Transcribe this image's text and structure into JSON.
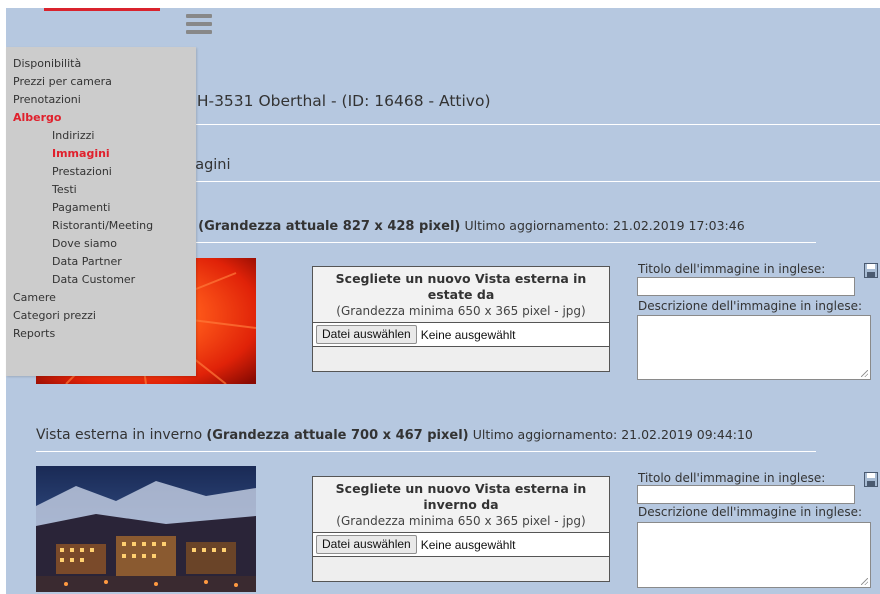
{
  "page": {
    "title": "CH-3531 Oberthal - (ID: 16468 - Attivo)",
    "section_title": "nagini"
  },
  "menu": {
    "items": [
      {
        "label": "Disponibilità",
        "level": 0,
        "active": false
      },
      {
        "label": "Prezzi per camera",
        "level": 0,
        "active": false
      },
      {
        "label": "Prenotazioni",
        "level": 0,
        "active": false
      },
      {
        "label": "Albergo",
        "level": 0,
        "active": true
      },
      {
        "label": "Indirizzi",
        "level": 1,
        "active": false
      },
      {
        "label": "Immagini",
        "level": 1,
        "active": true
      },
      {
        "label": "Prestazioni",
        "level": 1,
        "active": false
      },
      {
        "label": "Testi",
        "level": 1,
        "active": false
      },
      {
        "label": "Pagamenti",
        "level": 1,
        "active": false
      },
      {
        "label": "Ristoranti/Meeting",
        "level": 1,
        "active": false
      },
      {
        "label": "Dove siamo",
        "level": 1,
        "active": false
      },
      {
        "label": "Data Partner",
        "level": 1,
        "active": false
      },
      {
        "label": "Data Customer",
        "level": 1,
        "active": false
      },
      {
        "label": "Camere",
        "level": 0,
        "active": false
      },
      {
        "label": "Categori prezzi",
        "level": 0,
        "active": false
      },
      {
        "label": "Reports",
        "level": 0,
        "active": false
      }
    ]
  },
  "images": [
    {
      "name": "e",
      "size": "(Grandezza attuale 827 x 428 pixel)",
      "updated": "Ultimo aggiornamento: 21.02.2019 17:03:46",
      "upload_title": "Scegliete un nuovo Vista esterna in estate da",
      "upload_hint": "(Grandezza minima 650 x 365 pixel - jpg)",
      "file_button": "Datei auswählen",
      "file_status": "Keine ausgewählt",
      "title_label": "Titolo dell'immagine in inglese:",
      "desc_label": "Descrizione dell'immagine in inglese:",
      "title_value": "",
      "desc_value": ""
    },
    {
      "name": "Vista esterna in inverno",
      "size": "(Grandezza attuale 700 x 467 pixel)",
      "updated": "Ultimo aggiornamento: 21.02.2019 09:44:10",
      "upload_title": "Scegliete un nuovo Vista esterna in inverno da",
      "upload_hint": "(Grandezza minima 650 x 365 pixel - jpg)",
      "file_button": "Datei auswählen",
      "file_status": "Keine ausgewählt",
      "title_label": "Titolo dell'immagine in inglese:",
      "desc_label": "Descrizione dell'immagine in inglese:",
      "title_value": "",
      "desc_value": ""
    }
  ],
  "icons": {
    "menu": "hamburger-icon",
    "save": "save-icon"
  },
  "colors": {
    "background": "#b6c8e0",
    "menu_bg": "#cccccc",
    "active": "#e0202c"
  }
}
